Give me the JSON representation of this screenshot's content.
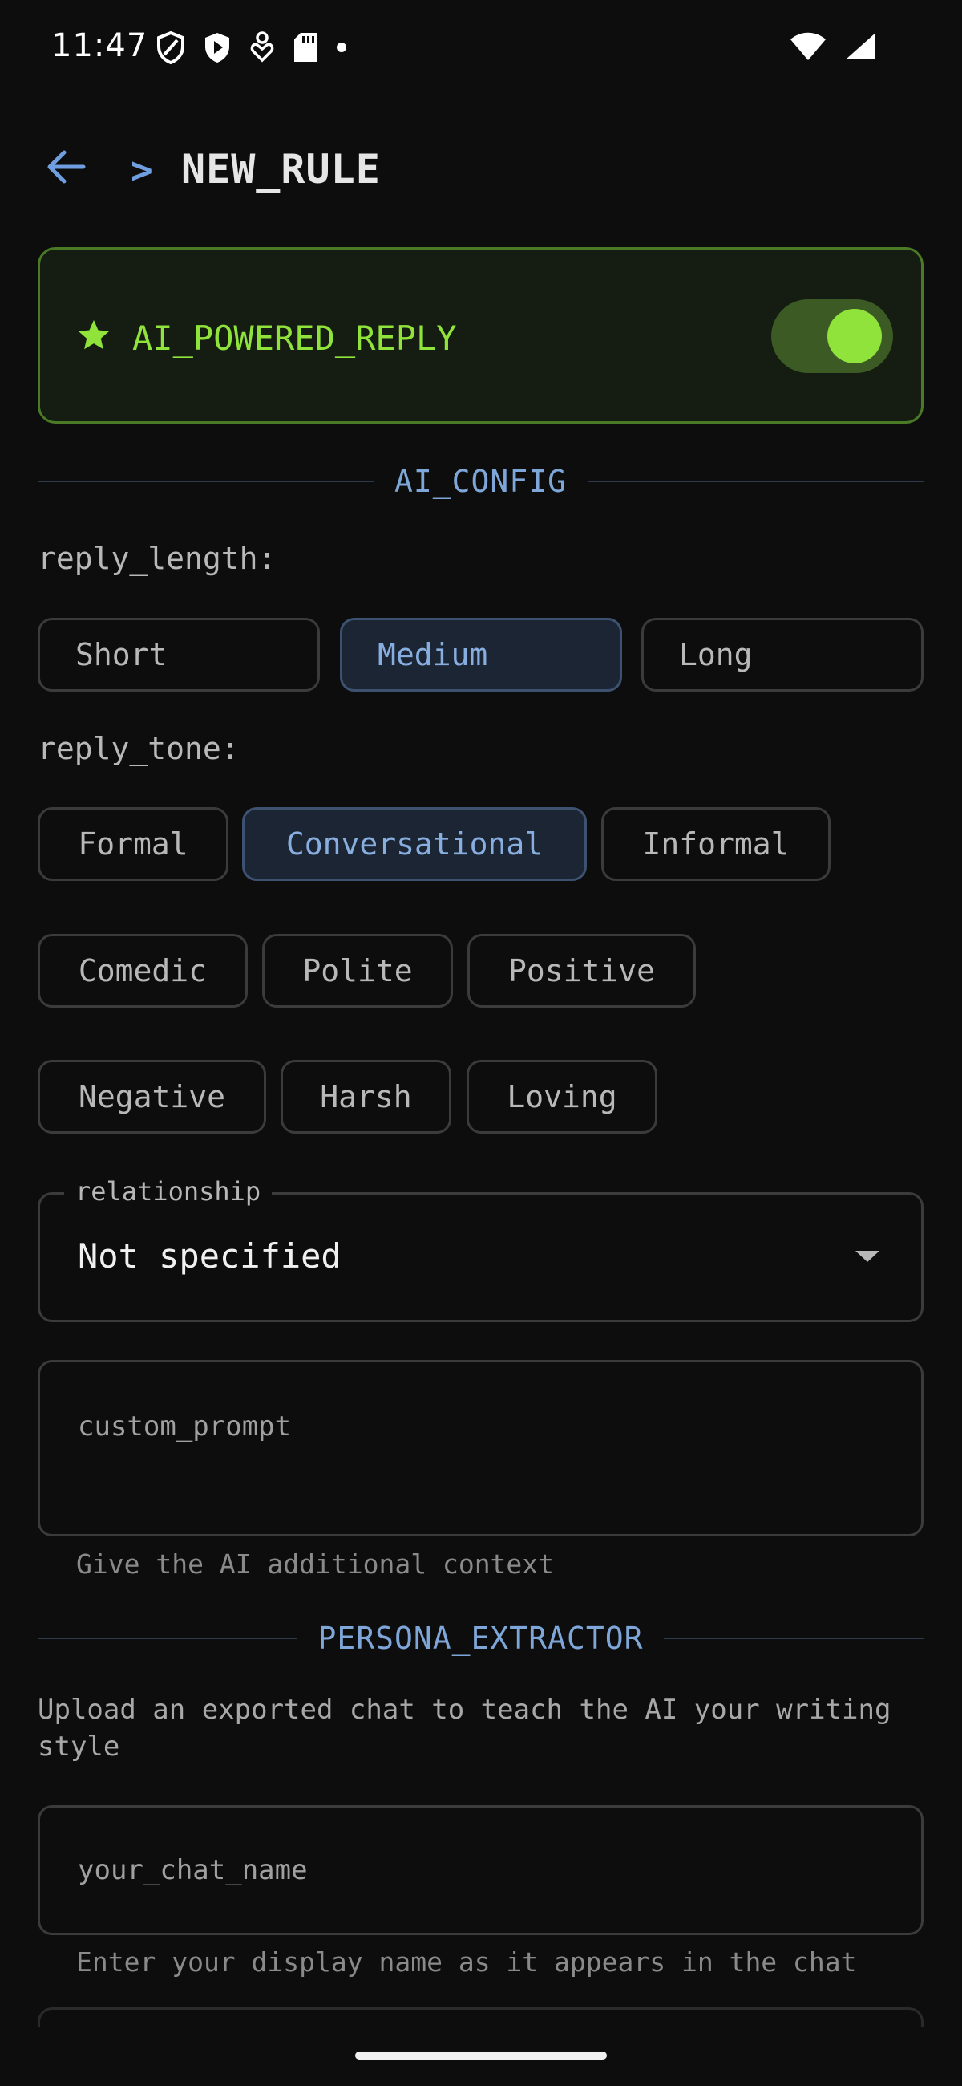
{
  "status_bar": {
    "time": "11:47",
    "left_icons": [
      "shield-outline-icon",
      "shield-play-icon",
      "person-heart-icon",
      "sd-card-icon",
      "dot-icon"
    ],
    "right_icons": [
      "wifi-icon",
      "signal-icon"
    ]
  },
  "header": {
    "back_icon": "arrow-left-icon",
    "prompt": ">",
    "title": "NEW_RULE"
  },
  "ai_toggle": {
    "icon": "star-icon",
    "label": "AI_POWERED_REPLY",
    "enabled": true
  },
  "ai_config": {
    "section_title": "AI_CONFIG",
    "reply_length": {
      "label": "reply_length:",
      "options": [
        "Short",
        "Medium",
        "Long"
      ],
      "selected": "Medium"
    },
    "reply_tone": {
      "label": "reply_tone:",
      "options": [
        "Formal",
        "Conversational",
        "Informal",
        "Comedic",
        "Polite",
        "Positive",
        "Negative",
        "Harsh",
        "Loving"
      ],
      "selected": "Conversational"
    },
    "relationship": {
      "label": "relationship",
      "value": "Not specified"
    },
    "custom_prompt": {
      "placeholder": "custom_prompt",
      "helper": "Give the AI additional context"
    }
  },
  "persona_extractor": {
    "section_title": "PERSONA_EXTRACTOR",
    "description": "Upload an exported chat to teach the AI your writing style",
    "chat_name": {
      "placeholder": "your_chat_name",
      "helper": "Enter your display name as it appears in the chat"
    }
  },
  "colors": {
    "background": "#0d0d0d",
    "accent_green": "#8fe33a",
    "accent_blue": "#7ea6d8",
    "border": "#3b3b3b"
  }
}
